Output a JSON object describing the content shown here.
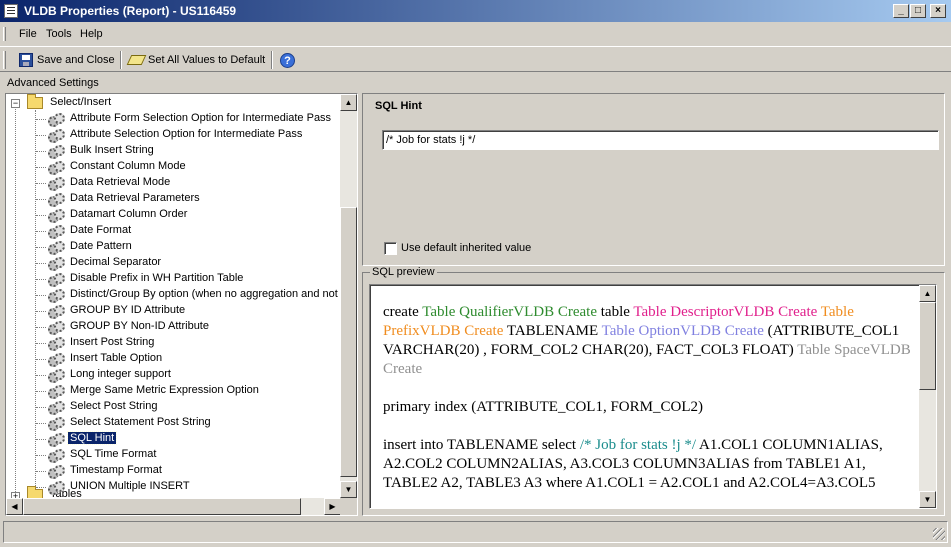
{
  "window": {
    "title": "VLDB Properties (Report) - US116459",
    "minimize_glyph": "_",
    "maximize_glyph": "□",
    "close_glyph": "×"
  },
  "menu": {
    "file": "File",
    "tools": "Tools",
    "help": "Help"
  },
  "toolbar": {
    "save_close": "Save and Close",
    "set_default": "Set All Values to Default",
    "help_glyph": "?"
  },
  "advanced_settings_label": "Advanced Settings",
  "tree": {
    "root_expander": "−",
    "root_label": "Select/Insert",
    "items": [
      "Attribute Form Selection Option for Intermediate Pass",
      "Attribute Selection Option for Intermediate Pass",
      "Bulk Insert String",
      "Constant Column Mode",
      "Data Retrieval Mode",
      "Data Retrieval Parameters",
      "Datamart Column Order",
      "Date Format",
      "Date Pattern",
      "Decimal Separator",
      "Disable Prefix in WH Partition Table",
      "Distinct/Group By option (when no aggregation and not table key)",
      "GROUP BY ID Attribute",
      "GROUP BY Non-ID Attribute",
      "Insert Post String",
      "Insert Table Option",
      "Long integer support",
      "Merge Same Metric Expression Option",
      "Select Post String",
      "Select Statement Post String",
      "SQL Hint",
      "SQL Time Format",
      "Timestamp Format",
      "UNION Multiple INSERT"
    ],
    "selected_index": 20,
    "next_group_expander": "+",
    "next_group_label": "Tables"
  },
  "scroll_glyphs": {
    "up": "▲",
    "down": "▼",
    "left": "◀",
    "right": "▶"
  },
  "sql_hint": {
    "title": "SQL Hint",
    "value": "/* Job for stats !j */",
    "use_default_label": "Use default inherited value",
    "use_default_checked": false
  },
  "sql_preview": {
    "label": "SQL preview",
    "p1": {
      "t1": "create ",
      "q": "Table QualifierVLDB Create",
      "t2": " table ",
      "d": "Table DescriptorVLDB Create",
      "t3": " ",
      "p": "Table PrefixVLDB Create",
      "t4": " TABLENAME ",
      "o": "Table OptionVLDB Create",
      "t5": " (ATTRIBUTE_COL1 VARCHAR(20) , FORM_COL2 CHAR(20), FACT_COL3 FLOAT) ",
      "s": "Table SpaceVLDB Create"
    },
    "p2": "primary index (ATTRIBUTE_COL1, FORM_COL2)",
    "p3": {
      "t1": "insert into TABLENAME select ",
      "hint": "/* Job for stats !j */",
      "t2": " A1.COL1 COLUMN1ALIAS, A2.COL2 COLUMN2ALIAS, A3.COL3 COLUMN3ALIAS from TABLE1 A1, TABLE2 A2, TABLE3 A3 where A1.COL1 = A2.COL1 and A2.COL4=A3.COL5"
    }
  },
  "colors": {
    "qualifier": "#2e8b2e",
    "descriptor": "#e0208c",
    "prefix": "#f08c1e",
    "option": "#8080e0",
    "space": "#909090",
    "hint": "#1a8c8c",
    "selection": "#0a246a"
  }
}
